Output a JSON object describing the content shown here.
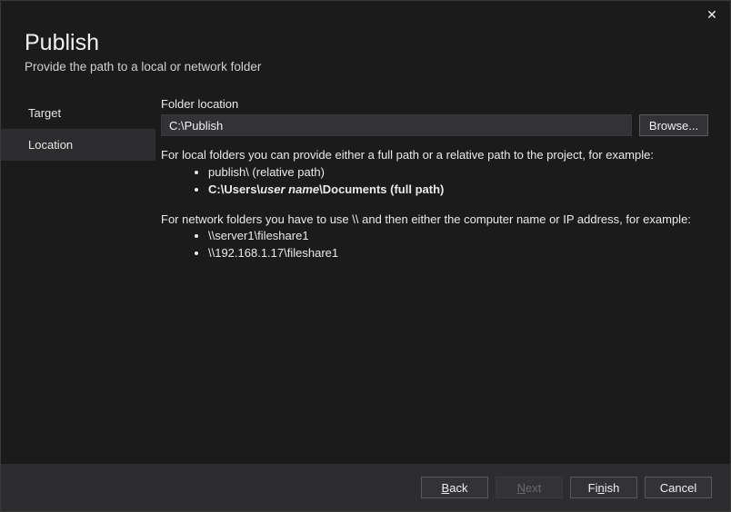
{
  "header": {
    "title": "Publish",
    "subtitle": "Provide the path to a local or network folder"
  },
  "sidebar": {
    "items": [
      "Target",
      "Location"
    ],
    "active_index": 1
  },
  "main": {
    "field_label": "Folder location",
    "input_value": "C:\\Publish",
    "browse_label": "Browse...",
    "help_local_intro": "For local folders you can provide either a full path or a relative path to the project, for example:",
    "help_local_ex1": "publish\\ (relative path)",
    "help_local_ex2_prefix": "C:\\Users\\",
    "help_local_ex2_ital": "user name",
    "help_local_ex2_suffix": "\\Documents (full path)",
    "help_net_intro": "For network folders you have to use \\\\ and then either the computer name or IP address, for example:",
    "help_net_ex1": "\\\\server1\\fileshare1",
    "help_net_ex2": "\\\\192.168.1.17\\fileshare1"
  },
  "footer": {
    "back": "ack",
    "back_mn": "B",
    "next": "ext",
    "next_mn": "N",
    "finish_pre": "Fi",
    "finish_mn": "n",
    "finish_post": "ish",
    "cancel": "Cancel"
  },
  "close_glyph": "✕"
}
